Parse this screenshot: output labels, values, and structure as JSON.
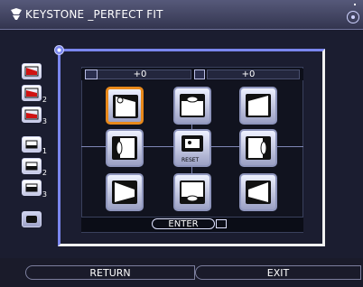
{
  "title": "KEYSTONE _PERFECT FIT",
  "values": {
    "horizontal": "+0",
    "vertical": "+0"
  },
  "side_buttons": [
    {
      "name": "memory-1",
      "sub": ""
    },
    {
      "name": "memory-2",
      "sub": "2"
    },
    {
      "name": "memory-3",
      "sub": "3"
    },
    {
      "name": "screen-1",
      "sub": "1"
    },
    {
      "name": "screen-2",
      "sub": "2"
    },
    {
      "name": "screen-3",
      "sub": "3"
    },
    {
      "name": "blank",
      "sub": ""
    }
  ],
  "tiles": [
    {
      "name": "top-left-corner",
      "label": ""
    },
    {
      "name": "top-edge",
      "label": ""
    },
    {
      "name": "top-right-corner",
      "label": ""
    },
    {
      "name": "left-edge",
      "label": ""
    },
    {
      "name": "reset",
      "label": "RESET"
    },
    {
      "name": "right-edge",
      "label": ""
    },
    {
      "name": "bottom-left-corner",
      "label": ""
    },
    {
      "name": "bottom-edge",
      "label": ""
    },
    {
      "name": "bottom-right-corner",
      "label": ""
    }
  ],
  "enter_label": "ENTER",
  "buttons": {
    "return": "RETURN",
    "exit": "EXIT"
  },
  "colors": {
    "selected": "#e8891b",
    "frame": "#7a86ee",
    "panel": "#11131f"
  }
}
